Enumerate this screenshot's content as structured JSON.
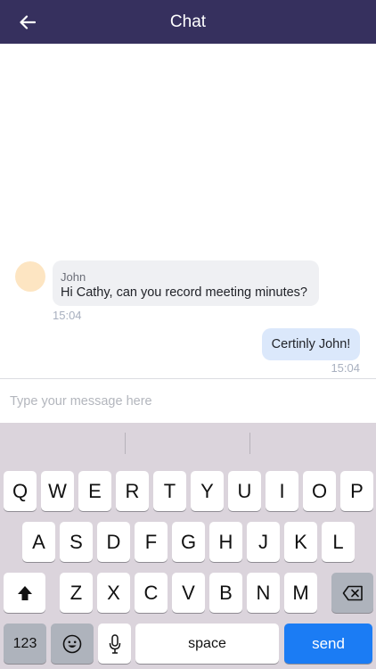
{
  "header": {
    "title": "Chat",
    "background": "#36305e"
  },
  "messages": [
    {
      "direction": "incoming",
      "sender": "John",
      "text": "Hi Cathy, can you record meeting minutes?",
      "time": "15:04"
    },
    {
      "direction": "outgoing",
      "text": "Certinly John!",
      "time": "15:04"
    }
  ],
  "composer": {
    "placeholder": "Type your message here"
  },
  "keyboard": {
    "row1": [
      "Q",
      "W",
      "E",
      "R",
      "T",
      "Y",
      "U",
      "I",
      "O",
      "P"
    ],
    "row2": [
      "A",
      "S",
      "D",
      "F",
      "G",
      "H",
      "J",
      "K",
      "L"
    ],
    "row3": [
      "Z",
      "X",
      "C",
      "V",
      "B",
      "N",
      "M"
    ],
    "numbers_label": "123",
    "space_label": "space",
    "send_label": "send",
    "send_color": "#1b7cf4"
  }
}
